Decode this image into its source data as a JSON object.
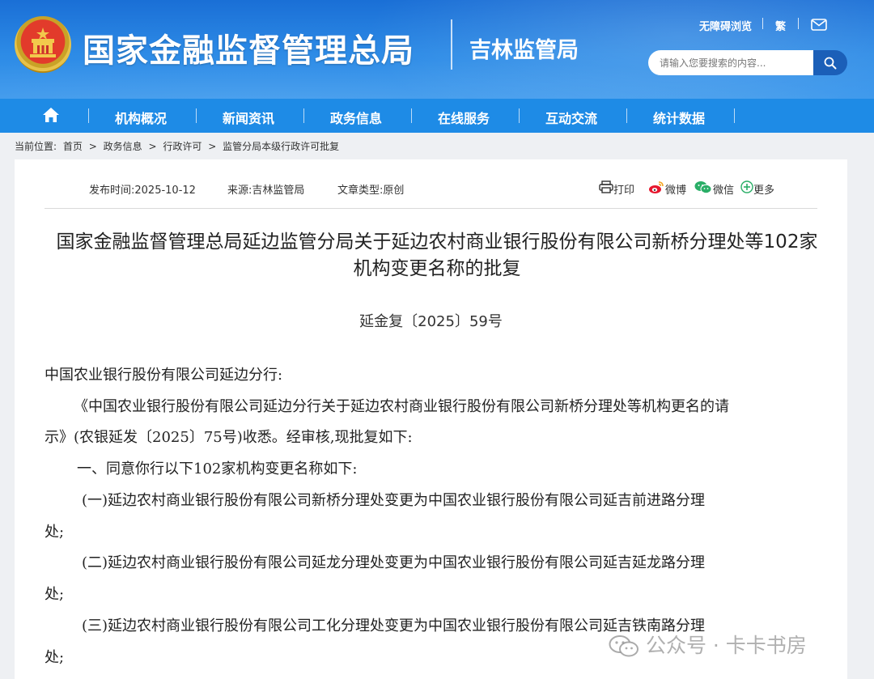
{
  "header": {
    "site_title": "国家金融监督管理总局",
    "sub_title": "吉林监管局",
    "util": {
      "accessible": "无障碍浏览",
      "traditional": "繁"
    },
    "search_placeholder": "请输入您要搜索的内容..."
  },
  "nav": {
    "items": [
      {
        "label": "机构概况"
      },
      {
        "label": "新闻资讯"
      },
      {
        "label": "政务信息"
      },
      {
        "label": "在线服务"
      },
      {
        "label": "互动交流"
      },
      {
        "label": "统计数据"
      }
    ]
  },
  "breadcrumb": {
    "prefix": "当前位置:",
    "items": [
      "首页",
      "政务信息",
      "行政许可",
      "监管分局本级行政许可批复"
    ],
    "sep": ">"
  },
  "meta": {
    "publish_time": "发布时间:2025-10-12",
    "source": "来源:吉林监管局",
    "article_type": "文章类型:原创"
  },
  "share": {
    "print": "打印",
    "weibo": "微博",
    "wechat": "微信",
    "more": "更多"
  },
  "document": {
    "title_line1": "国家金融监督管理总局延边监管分局关于延边农村商业银行股份有限公司新桥分理处等102家",
    "title_line2": "机构变更名称的批复",
    "number": "延金复〔2025〕59号",
    "paragraphs": [
      "中国农业银行股份有限公司延边分行:",
      "《中国农业银行股份有限公司延边分行关于延边农村商业银行股份有限公司新桥分理处等机构更名的请",
      "示》(农银延发〔2025〕75号)收悉。经审核,现批复如下:",
      "一、同意你行以下102家机构变更名称如下:",
      "(一)延边农村商业银行股份有限公司新桥分理处变更为中国农业银行股份有限公司延吉前进路分理",
      "处;",
      "(二)延边农村商业银行股份有限公司延龙分理处变更为中国农业银行股份有限公司延吉延龙路分理",
      "处;",
      "(三)延边农村商业银行股份有限公司工化分理处变更为中国农业银行股份有限公司延吉铁南路分理",
      "处;"
    ]
  },
  "watermark": "公众号 · 卡卡书房",
  "colors": {
    "header_blue": "#1a6fd6",
    "nav_blue": "#1e8be6",
    "search_btn": "#1b5fb8",
    "weibo_red": "#e6162d",
    "wechat_green": "#2aae67"
  }
}
